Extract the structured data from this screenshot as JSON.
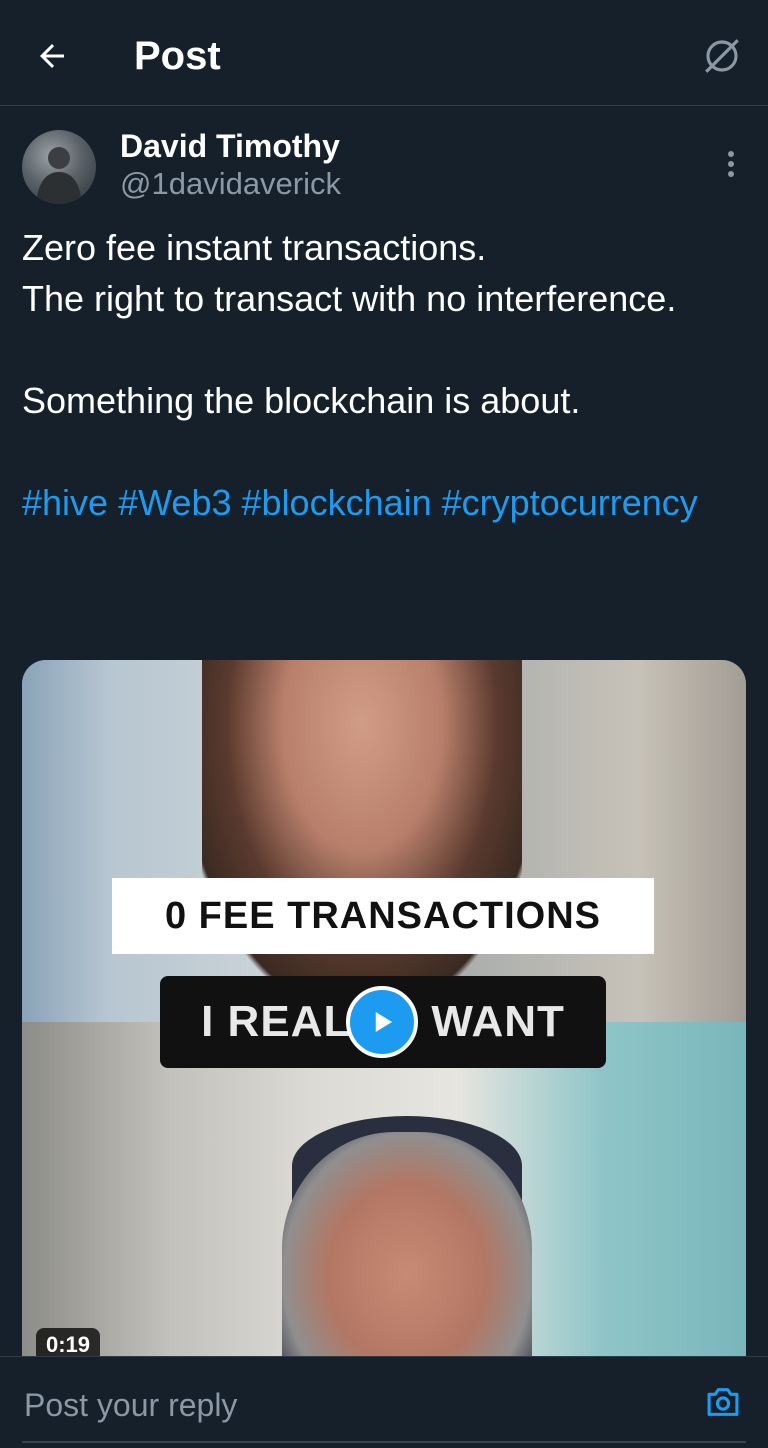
{
  "header": {
    "title": "Post"
  },
  "author": {
    "name": "David Timothy",
    "handle": "@1davidaverick"
  },
  "post": {
    "lines": [
      "Zero fee instant transactions.",
      "The right to transact with no interference.",
      "Something the blockchain is about."
    ],
    "hashtags": [
      "#hive",
      "#Web3",
      "#blockchain",
      "#cryptocurrency"
    ]
  },
  "media": {
    "caption_top": "0 FEE TRANSACTIONS",
    "caption_bottom_left": "I REAL",
    "caption_bottom_right": "WANT",
    "duration": "0:19"
  },
  "reply": {
    "placeholder": "Post your reply"
  },
  "colors": {
    "background": "#15202b",
    "accent": "#1d9bf0",
    "secondary_text": "#8b98a5"
  }
}
